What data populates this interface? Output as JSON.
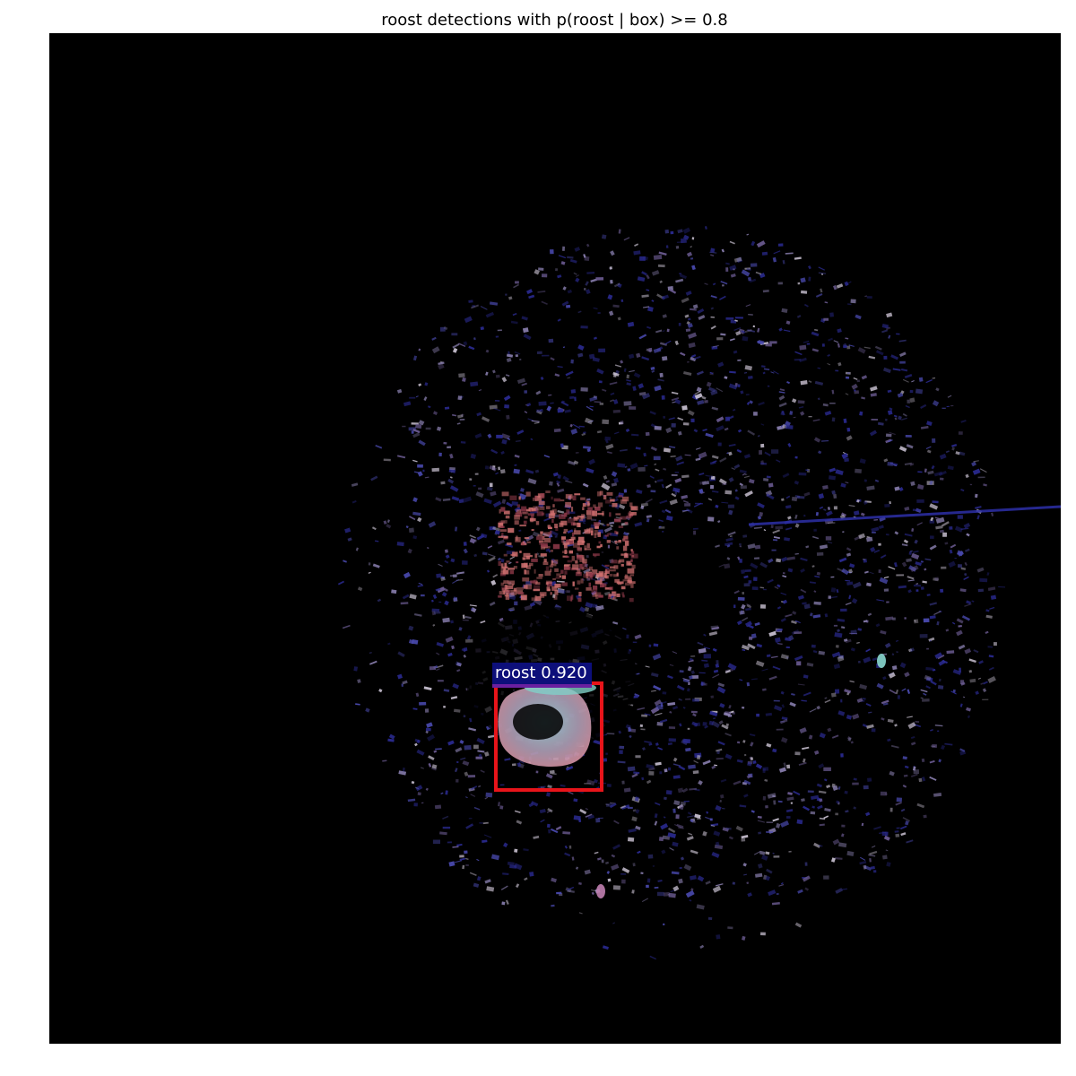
{
  "title": "roost detections with p(roost | box) >= 0.8",
  "detection": {
    "label": "roost 0.920",
    "class": "roost",
    "score": 0.92,
    "box_color": "#e8141a",
    "label_bg_color": "#0d0f7a"
  },
  "colors": {
    "background": "#000000",
    "echo_white": "#c8c0d0",
    "echo_pink": "#d07070",
    "echo_blue": "#2a2a90",
    "roost_cyan": "#8ad8d0"
  }
}
